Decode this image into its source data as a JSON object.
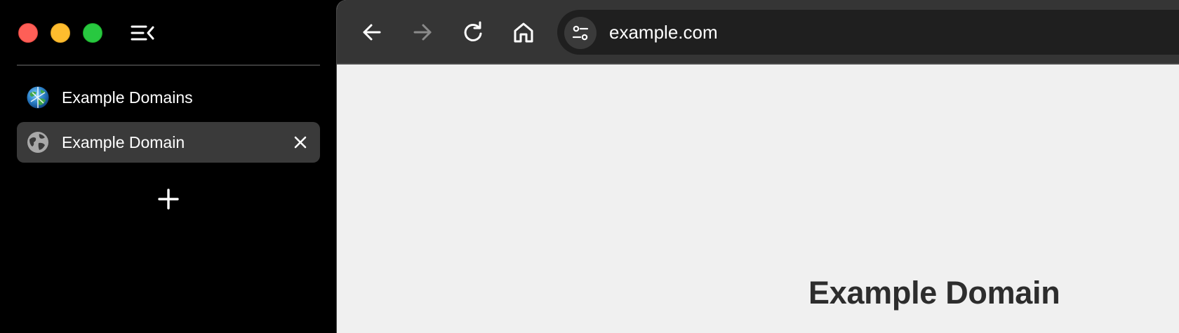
{
  "window": {
    "traffic_lights": {
      "close_color": "#fe5f57",
      "minimize_color": "#febc2e",
      "maximize_color": "#28c840"
    }
  },
  "sidebar": {
    "toggle_icon": "sidebar-collapse-icon",
    "tabs": [
      {
        "label": "Example Domains",
        "favicon": "globe-color-favicon-icon",
        "active": false
      },
      {
        "label": "Example Domain",
        "favicon": "globe-grey-favicon-icon",
        "active": true,
        "close_icon": "close-icon"
      }
    ],
    "new_tab_icon": "plus-icon"
  },
  "toolbar": {
    "back_icon": "arrow-left-icon",
    "forward_icon": "arrow-right-icon",
    "reload_icon": "reload-icon",
    "home_icon": "home-icon",
    "site_info_icon": "tune-icon",
    "url": "example.com"
  },
  "page": {
    "heading": "Example Domain"
  },
  "colors": {
    "sidebar_bg": "#000000",
    "active_tab_bg": "#3a3a3a",
    "toolbar_bg": "#353535",
    "omnibox_bg": "#1f1f1f",
    "content_bg": "#f0f0f0",
    "heading_color": "#2d2d2d"
  }
}
